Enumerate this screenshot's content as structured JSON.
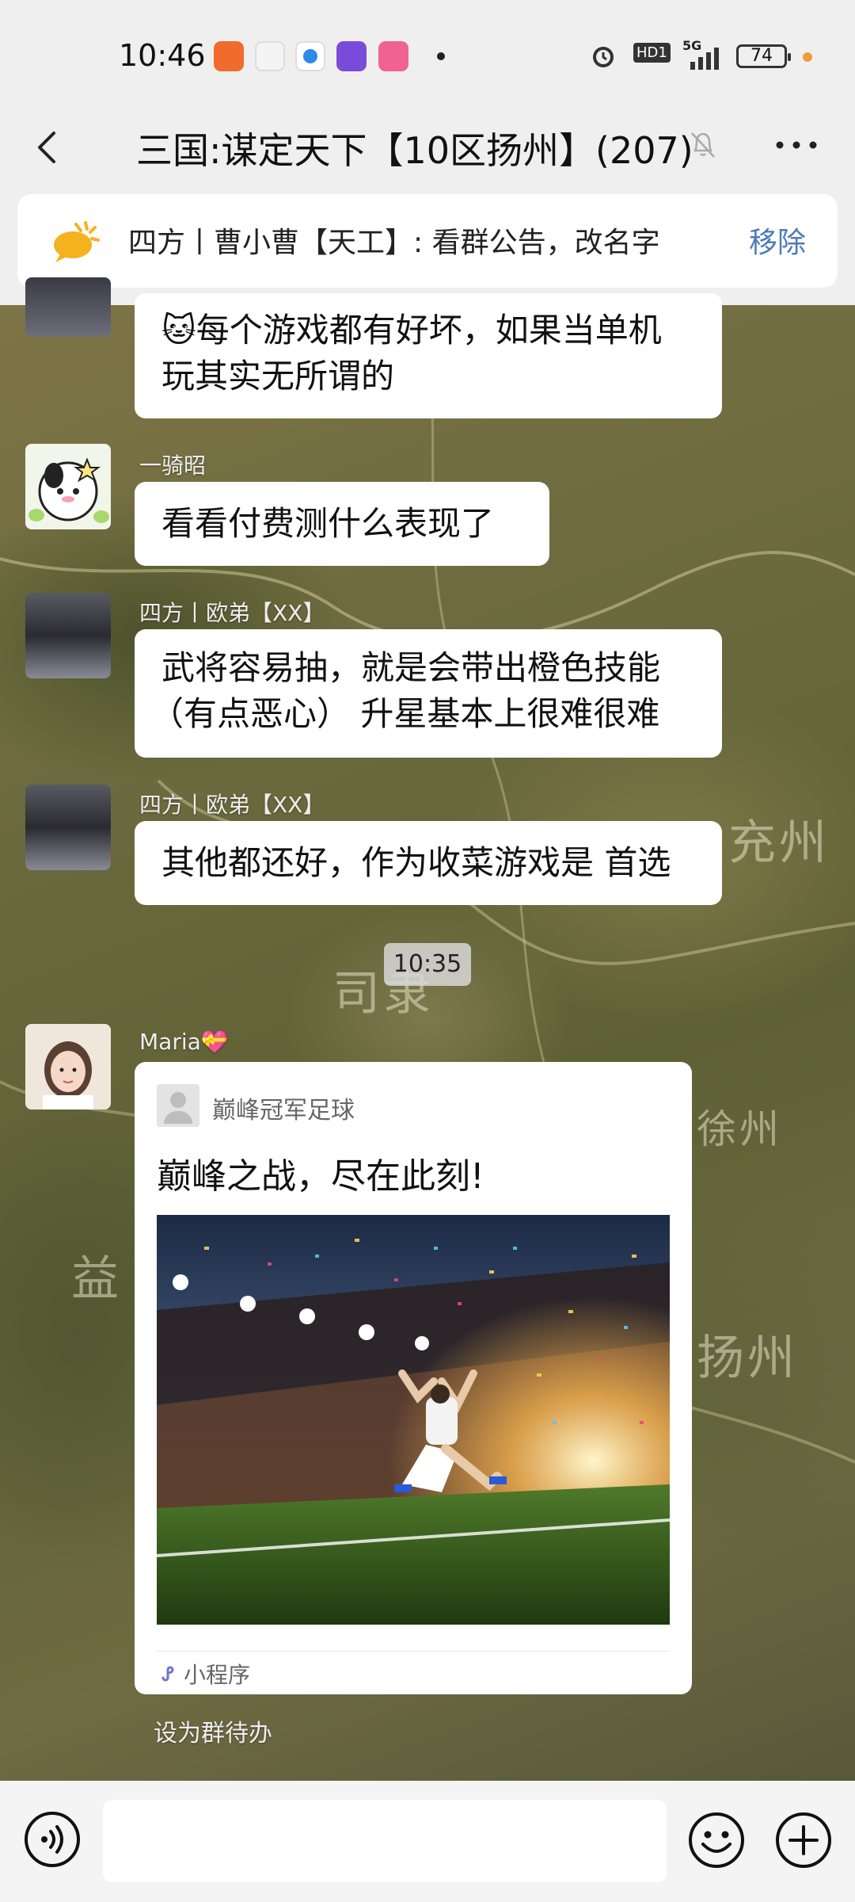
{
  "status_bar": {
    "time": "10:46",
    "signal_label": "5G",
    "hd_label": "HD1",
    "battery": "74"
  },
  "header": {
    "title": "三国:谋定天下【10区扬州】(207)"
  },
  "announcement": {
    "text": "四方丨曹小曹【天工】: 看群公告，改名字",
    "action": "移除"
  },
  "map_labels": [
    "充州",
    "司隶",
    "益",
    "扬州",
    "徐州"
  ],
  "messages": [
    {
      "sender": "",
      "text_lines": [
        "每个游戏都有好坏，如果当单机",
        "玩其实无所谓的"
      ],
      "emoji": "🐱"
    },
    {
      "sender": "一骑昭",
      "text_lines": [
        "看看付费测什么表现了"
      ]
    },
    {
      "sender": "四方丨欧弟【XX】",
      "text_lines": [
        "武将容易抽，就是会带出橙色技能",
        "（有点恶心） 升星基本上很难很难"
      ]
    },
    {
      "sender": "四方丨欧弟【XX】",
      "text_lines": [
        "其他都还好，作为收菜游戏是 首选"
      ]
    }
  ],
  "time_separator": "10:35",
  "card_message": {
    "sender": "Maria💝",
    "app_name": "巅峰冠军足球",
    "title": "巅峰之战，尽在此刻!",
    "footer_label": "小程序",
    "below_action": "设为群待办"
  },
  "input": {
    "placeholder": ""
  },
  "colors": {
    "accent_link": "#4a7bb7",
    "notice_icon": "#f5b21f"
  }
}
